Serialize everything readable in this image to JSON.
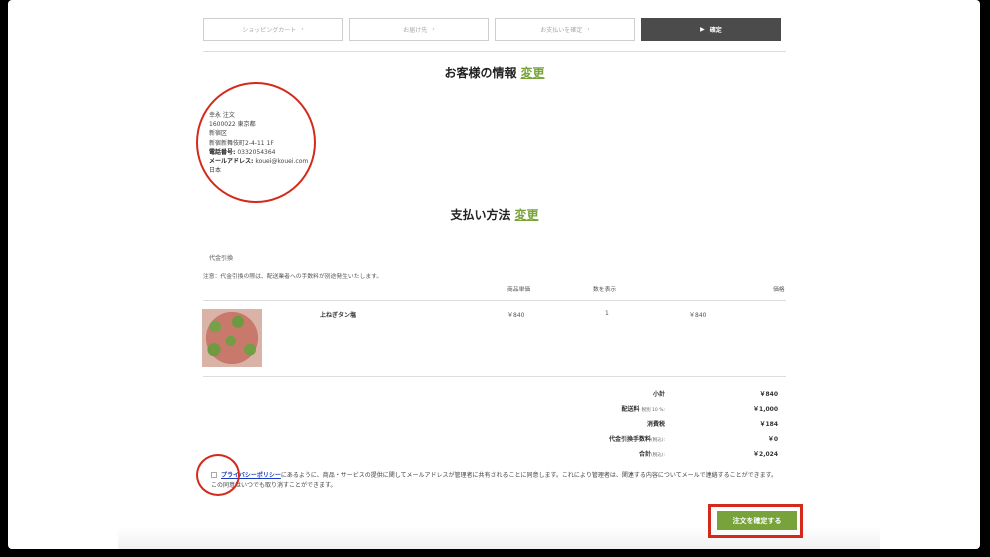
{
  "steps": [
    {
      "label": "ショッピングカート",
      "chevron": "›"
    },
    {
      "label": "お届け先",
      "chevron": "›"
    },
    {
      "label": "お支払いを確定",
      "chevron": "›"
    },
    {
      "label": "確定",
      "arrow": "▶"
    }
  ],
  "customer_section": {
    "title": "お客様の情報",
    "change_label": "変更"
  },
  "address": {
    "name": "幸永 注文",
    "postal_pref": "1600022 東京都",
    "ward": "新宿区",
    "street": "新宿新舞伎町2-4-11 1F",
    "phone_label": "電話番号:",
    "phone": " 0332054364",
    "email_label": "メールアドレス:",
    "email": " kouei@kouei.com",
    "country": "日本"
  },
  "payment_section": {
    "title": "支払い方法",
    "change_label": "変更"
  },
  "payment": {
    "method": "代金引換",
    "notice": "注意：代金引換の際は、配送業者への手数料が別途発生いたします。"
  },
  "table": {
    "headers": {
      "unit_price": "商品単価",
      "quantity": "数を表示",
      "price": "価格"
    },
    "items": [
      {
        "name": "上ねぎタン塩",
        "unit_price": "￥840",
        "quantity": "1",
        "price": "￥840"
      }
    ]
  },
  "summary": [
    {
      "label": "小計",
      "note": "",
      "value": "￥840"
    },
    {
      "label": "配送料",
      "note": "税別 10 %:",
      "value": "￥1,000"
    },
    {
      "label": "消費税",
      "note": "",
      "value": "￥184"
    },
    {
      "label": "代金引換手数料",
      "note": "(税込):",
      "value": "￥0"
    },
    {
      "label": "合計",
      "note": "(税込):",
      "value": "￥2,024"
    }
  ],
  "consent": {
    "link": "プライバシーポリシー",
    "text": "にあるように、商品・サービスの提供に関してメールアドレスが管理者に共有されることに同意します。これにより管理者は、関連する内容についてメールで連絡することができます。この同意はいつでも取り消すことができます。"
  },
  "confirm_button": "注文を確定する",
  "colors": {
    "accent": "#78a33b",
    "annotation": "#d42a1c"
  }
}
